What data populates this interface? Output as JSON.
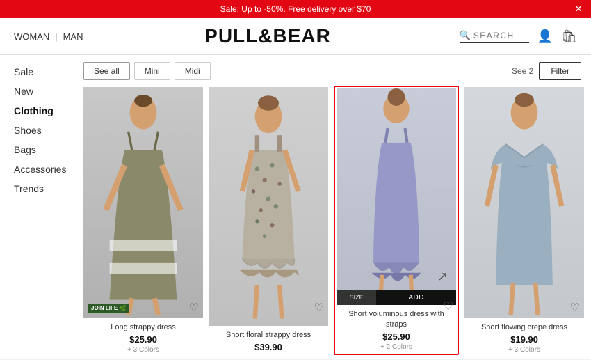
{
  "banner": {
    "text": "Sale: Up to -50%. Free delivery over $70",
    "close": "✕"
  },
  "header": {
    "woman": "WOMAN",
    "divider": "|",
    "man": "MAN",
    "logo": "PULL&BEAR",
    "search_placeholder": "SEARCH"
  },
  "sidebar": {
    "items": [
      {
        "label": "Sale",
        "active": false
      },
      {
        "label": "New",
        "active": false
      },
      {
        "label": "Clothing",
        "active": true
      },
      {
        "label": "Shoes",
        "active": false
      },
      {
        "label": "Bags",
        "active": false
      },
      {
        "label": "Accessories",
        "active": false
      },
      {
        "label": "Trends",
        "active": false
      }
    ]
  },
  "filter_bar": {
    "see_all": "See all",
    "mini": "Mini",
    "midi": "Midi",
    "see_count": "See 2",
    "filter": "Filter"
  },
  "products": [
    {
      "name": "Long strappy dress",
      "price": "$25.90",
      "colors": "+ 3 Colors",
      "badge": "JOIN LIFE",
      "image_type": "dress1"
    },
    {
      "name": "Short floral strappy dress",
      "price": "$39.90",
      "colors": "",
      "image_type": "dress2"
    },
    {
      "name": "Short voluminous dress with straps",
      "price": "$25.90",
      "colors": "+ 2 Colors",
      "highlighted": true,
      "size_label": "SIZE",
      "add_label": "ADD",
      "image_type": "dress3"
    },
    {
      "name": "Short flowing crepe dress",
      "price": "$19.90",
      "colors": "+ 3 Colors",
      "image_type": "dress4"
    }
  ]
}
